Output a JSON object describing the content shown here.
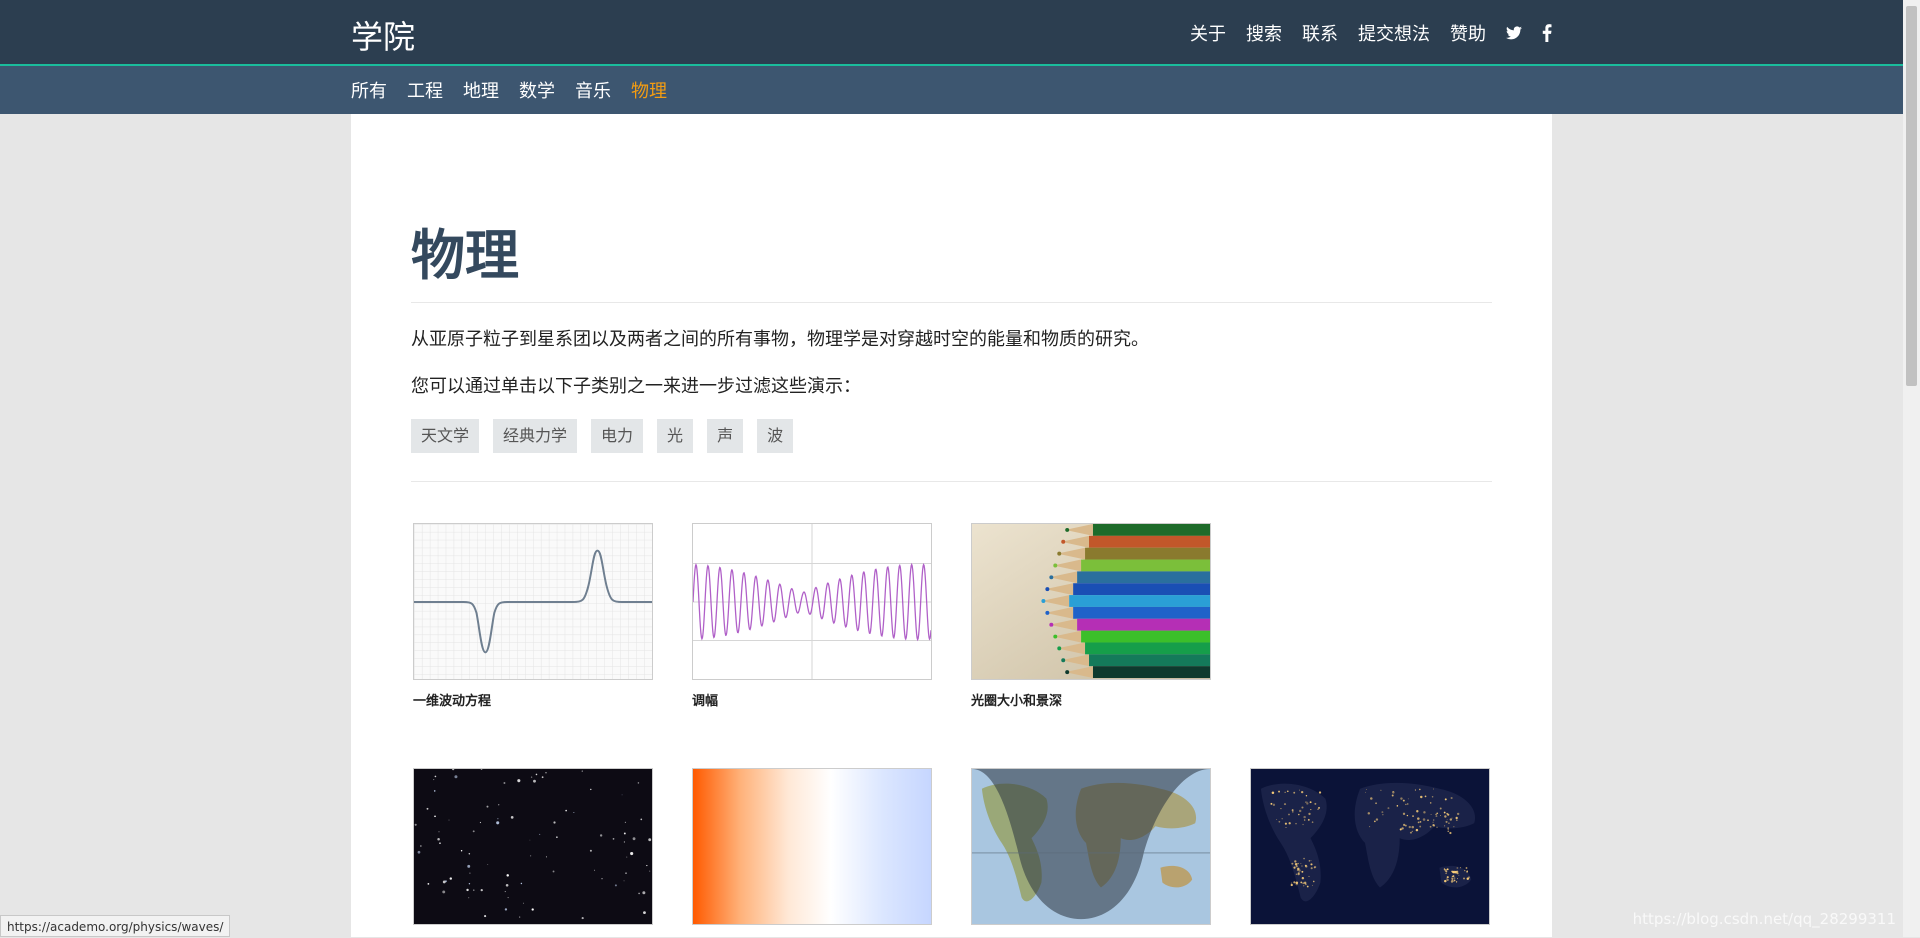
{
  "header": {
    "brand": "学院",
    "nav": [
      "关于",
      "搜索",
      "联系",
      "提交想法",
      "赞助"
    ]
  },
  "subnav": {
    "items": [
      "所有",
      "工程",
      "地理",
      "数学",
      "音乐",
      "物理"
    ],
    "active": "物理"
  },
  "main": {
    "title": "物理",
    "intro": "从亚原子粒子到星系团以及两者之间的所有事物，物理学是对穿越时空的能量和物质的研究。",
    "filter_prompt": "您可以通过单击以下子类别之一来进一步过滤这些演示：",
    "tags": [
      "天文学",
      "经典力学",
      "电力",
      "光",
      "声",
      "波"
    ],
    "demos_row1": [
      {
        "caption": "一维波动方程",
        "thumb": "wave-pulse-thumbnail"
      },
      {
        "caption": "调幅",
        "thumb": "amplitude-modulation-thumbnail"
      },
      {
        "caption": "光圈大小和景深",
        "thumb": "colored-pencils-thumbnail"
      }
    ],
    "demos_row2": [
      {
        "thumb": "starfield-thumbnail"
      },
      {
        "thumb": "color-gradient-thumbnail"
      },
      {
        "thumb": "world-map-daylight-thumbnail"
      },
      {
        "thumb": "earth-night-lights-thumbnail"
      }
    ]
  },
  "status_url": "https://academo.org/physics/waves/",
  "watermark": "https://blog.csdn.net/qq_28299311",
  "colors": {
    "header_bg": "#2c3e50",
    "subnav_bg": "#3d5670",
    "accent": "#f39c12",
    "title": "#34495e",
    "border_accent": "#1abc9c"
  },
  "icons": [
    "twitter-icon",
    "facebook-icon"
  ]
}
